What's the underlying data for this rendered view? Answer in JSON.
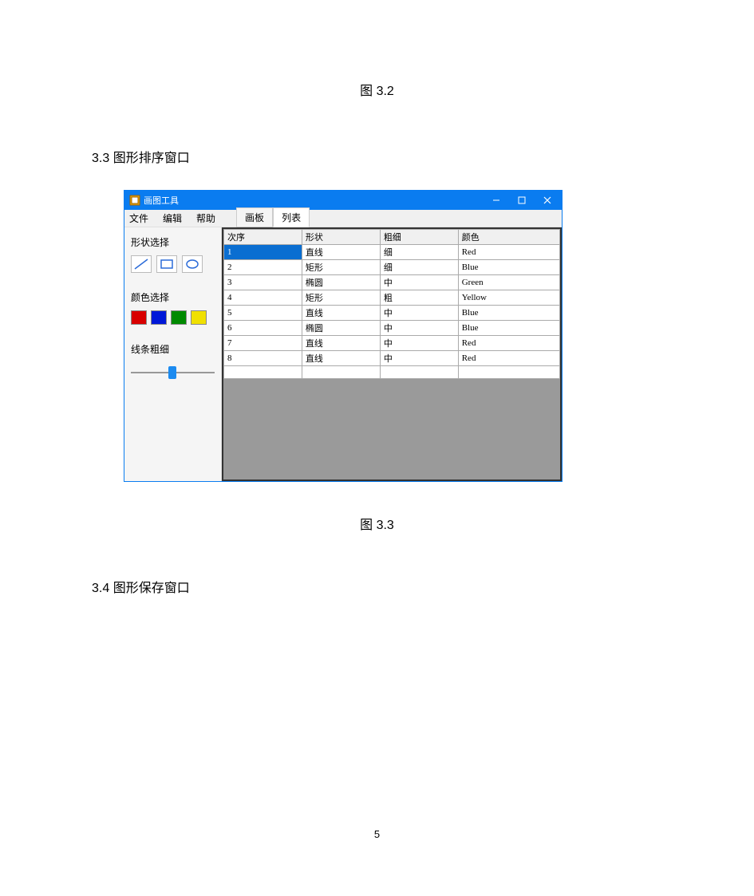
{
  "labels": {
    "fig_top": "图 3.2",
    "section_3_3": "3.3 图形排序窗口",
    "fig_mid": "图 3.3",
    "section_3_4": "3.4 图形保存窗口",
    "page_number": "5"
  },
  "window": {
    "title": "画图工具",
    "menu": {
      "file": "文件",
      "edit": "编辑",
      "help": "帮助"
    },
    "tabs": {
      "board": "画板",
      "list": "列表"
    }
  },
  "sidebar": {
    "shape_label": "形状选择",
    "color_label": "颜色选择",
    "thickness_label": "线条粗细",
    "colors": {
      "red": "#d80000",
      "blue": "#0018d8",
      "green": "#008a00",
      "yellow": "#f0e000"
    }
  },
  "table": {
    "headers": {
      "seq": "次序",
      "shape": "形状",
      "thickness": "粗细",
      "color": "颜色"
    },
    "rows": [
      {
        "seq": "1",
        "shape": "直线",
        "thickness": "细",
        "color": "Red"
      },
      {
        "seq": "2",
        "shape": "矩形",
        "thickness": "细",
        "color": "Blue"
      },
      {
        "seq": "3",
        "shape": "椭圆",
        "thickness": "中",
        "color": "Green"
      },
      {
        "seq": "4",
        "shape": "矩形",
        "thickness": "粗",
        "color": "Yellow"
      },
      {
        "seq": "5",
        "shape": "直线",
        "thickness": "中",
        "color": "Blue"
      },
      {
        "seq": "6",
        "shape": "椭圆",
        "thickness": "中",
        "color": "Blue"
      },
      {
        "seq": "7",
        "shape": "直线",
        "thickness": "中",
        "color": "Red"
      },
      {
        "seq": "8",
        "shape": "直线",
        "thickness": "中",
        "color": "Red"
      }
    ]
  }
}
